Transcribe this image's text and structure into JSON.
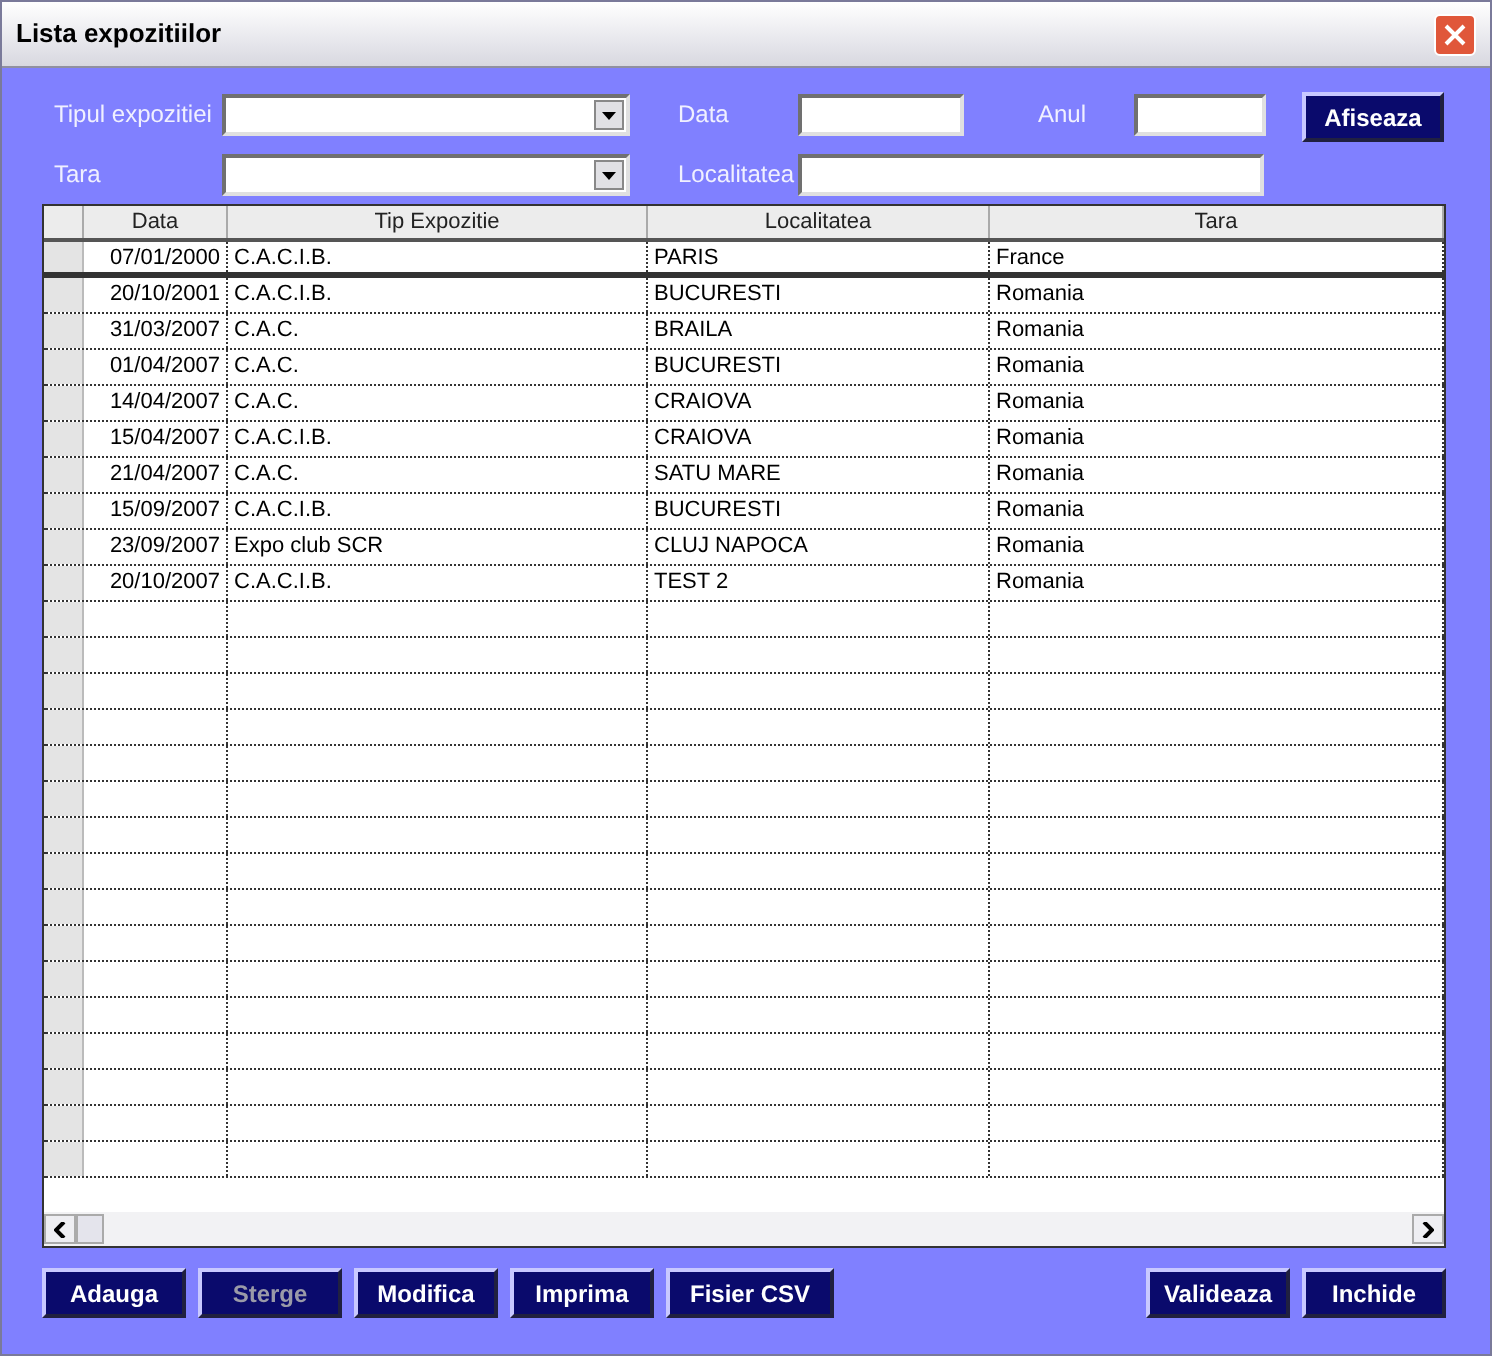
{
  "window": {
    "title": "Lista expozitiilor"
  },
  "filters": [
    {
      "kind": "combo",
      "label": "Tipul expozitiei"
    },
    {
      "kind": "text",
      "label": "Data"
    },
    {
      "kind": "text",
      "label": "Anul"
    },
    {
      "kind": "combo",
      "label": "Tara"
    },
    {
      "kind": "text",
      "label": "Localitatea"
    }
  ],
  "show_button": {
    "label": "Afiseaza",
    "disabled": false
  },
  "table": {
    "columns": [
      "Data",
      "Tip Expozitie",
      "Localitatea",
      "Tara"
    ],
    "rows": [
      {
        "selected": true,
        "cells": [
          "07/01/2000",
          "C.A.C.I.B.",
          "PARIS",
          "France"
        ]
      },
      {
        "selected": false,
        "cells": [
          "20/10/2001",
          "C.A.C.I.B.",
          "BUCURESTI",
          "Romania"
        ]
      },
      {
        "selected": false,
        "cells": [
          "31/03/2007",
          "C.A.C.",
          "BRAILA",
          "Romania"
        ]
      },
      {
        "selected": false,
        "cells": [
          "01/04/2007",
          "C.A.C.",
          "BUCURESTI",
          "Romania"
        ]
      },
      {
        "selected": false,
        "cells": [
          "14/04/2007",
          "C.A.C.",
          "CRAIOVA",
          "Romania"
        ]
      },
      {
        "selected": false,
        "cells": [
          "15/04/2007",
          "C.A.C.I.B.",
          "CRAIOVA",
          "Romania"
        ]
      },
      {
        "selected": false,
        "cells": [
          "21/04/2007",
          "C.A.C.",
          "SATU MARE",
          "Romania"
        ]
      },
      {
        "selected": false,
        "cells": [
          "15/09/2007",
          "C.A.C.I.B.",
          "BUCURESTI",
          "Romania"
        ]
      },
      {
        "selected": false,
        "cells": [
          "23/09/2007",
          "Expo club SCR",
          "CLUJ NAPOCA",
          "Romania"
        ]
      },
      {
        "selected": false,
        "cells": [
          "20/10/2007",
          "C.A.C.I.B.",
          "TEST 2",
          "Romania"
        ]
      }
    ]
  },
  "buttons_left": [
    {
      "label": "Adauga",
      "disabled": false
    },
    {
      "label": "Sterge",
      "disabled": true
    },
    {
      "label": "Modifica",
      "disabled": false
    },
    {
      "label": "Imprima",
      "disabled": false
    },
    {
      "label": "Fisier CSV",
      "disabled": false
    }
  ],
  "buttons_right": [
    {
      "label": "Valideaza",
      "disabled": false
    },
    {
      "label": "Inchide",
      "disabled": false
    }
  ]
}
